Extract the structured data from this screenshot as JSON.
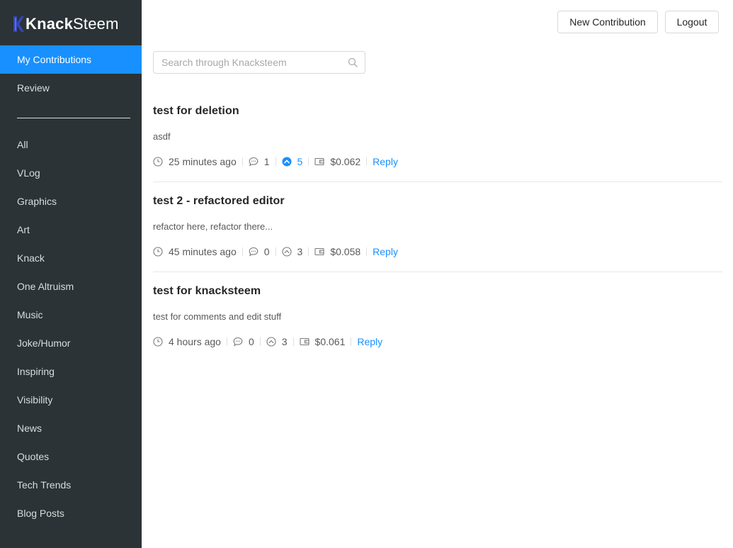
{
  "app": {
    "logo_part1": "Knack",
    "logo_part2": "Steem"
  },
  "sidebar": {
    "top_items": [
      {
        "label": "My Contributions",
        "active": true
      },
      {
        "label": "Review",
        "active": false
      }
    ],
    "categories": [
      "All",
      "VLog",
      "Graphics",
      "Art",
      "Knack",
      "One Altruism",
      "Music",
      "Joke/Humor",
      "Inspiring",
      "Visibility",
      "News",
      "Quotes",
      "Tech Trends",
      "Blog Posts"
    ]
  },
  "header": {
    "new_contribution_label": "New Contribution",
    "logout_label": "Logout"
  },
  "search": {
    "placeholder": "Search through Knacksteem",
    "value": ""
  },
  "posts": [
    {
      "title": "test for deletion",
      "body": "asdf",
      "time": "25 minutes ago",
      "comments": "1",
      "votes": "5",
      "voted": true,
      "payout": "$0.062",
      "reply_label": "Reply"
    },
    {
      "title": "test 2 - refactored editor",
      "body": "refactor here, refactor there...",
      "time": "45 minutes ago",
      "comments": "0",
      "votes": "3",
      "voted": false,
      "payout": "$0.058",
      "reply_label": "Reply"
    },
    {
      "title": "test for knacksteem",
      "body": "test for comments and edit stuff",
      "time": "4 hours ago",
      "comments": "0",
      "votes": "3",
      "voted": false,
      "payout": "$0.061",
      "reply_label": "Reply"
    }
  ],
  "colors": {
    "sidebar_bg": "#2b3336",
    "accent": "#1890ff",
    "logo_mark": "#2a3b9e"
  },
  "icons": {
    "time": "clock-icon",
    "comments": "comment-icon",
    "votes": "upvote-icon",
    "payout": "wallet-icon",
    "search": "search-icon"
  }
}
